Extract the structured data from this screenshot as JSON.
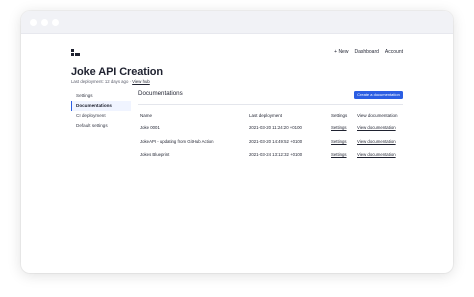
{
  "nav": {
    "links": [
      "+ New",
      "Dashboard",
      "Account"
    ]
  },
  "page": {
    "title": "Joke API Creation",
    "subtitle_prefix": "Last deployment: 12 days ago · ",
    "subtitle_link": "View hub"
  },
  "sidebar": {
    "items": [
      {
        "label": "Settings"
      },
      {
        "label": "Documentations"
      },
      {
        "label": "CI deployment"
      },
      {
        "label": "Default settings"
      }
    ],
    "active_index": 1
  },
  "main": {
    "section_title": "Documentations",
    "create_button": "Create a documentation",
    "columns": [
      "Name",
      "Last deployment",
      "Settings",
      "View documentation"
    ],
    "rows": [
      {
        "name": "Joke 0001",
        "last_deployment": "2021-03-20 11:24:20 +0100",
        "settings": "Settings",
        "view": "View documentation"
      },
      {
        "name": "JokeAPI - updating from GitHub Action",
        "last_deployment": "2021-03-20 14:49:52 +0100",
        "settings": "Settings",
        "view": "View documentation"
      },
      {
        "name": "Jokes Blueprint",
        "last_deployment": "2021-03-24 13:12:32 +0100",
        "settings": "Settings",
        "view": "View documentation"
      }
    ]
  },
  "colors": {
    "accent": "#2b5ee3",
    "text": "#1f2230",
    "titlebar": "#f1f2f6"
  }
}
